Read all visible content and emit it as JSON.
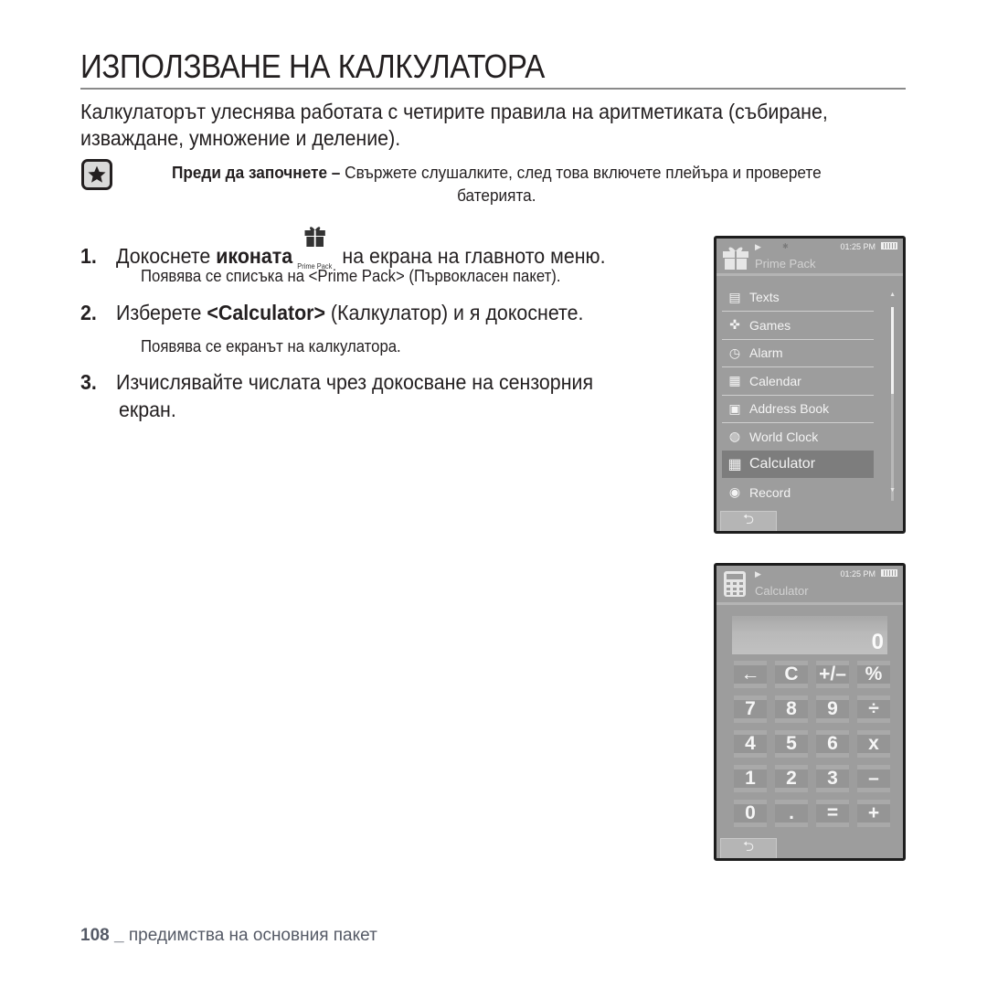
{
  "page": {
    "title": "ИЗПОЛЗВАНЕ НА КАЛКУЛАТОРА",
    "intro": "Калкулаторът улеснява работата с четирите правила на аритметиката (събиране, изваждане, умножение и деление).",
    "note": {
      "icon": "star-icon",
      "label": "Преди да започнете –",
      "text": "Свържете слушалките, след това включете плейъра и проверете батерията."
    },
    "steps": [
      {
        "num": "1.",
        "before": "Докоснете ",
        "bold": "иконата",
        "icon": "gift-icon",
        "icon_caption": "Prime Pack",
        "after": " на екрана на главното меню.",
        "sub": "Появява се списъка на <Prime Pack> (Първокласен пакет)."
      },
      {
        "num": "2.",
        "before": "Изберете ",
        "bold": "<Calculator>",
        "after": " (Калкулатор) и я докоснете.",
        "sub": "Появява се екранът на калкулатора."
      },
      {
        "num": "3.",
        "line1": "Изчислявайте числата чрез докосване на сензорния",
        "line2": "екран."
      }
    ],
    "footer": {
      "page_number": "108",
      "separator": "_",
      "section": "предимства на основния пакет"
    }
  },
  "screen_menu": {
    "status": {
      "play": "▶",
      "bluetooth": "✱",
      "time": "01:25 PM",
      "battery": "battery-icon"
    },
    "title": "Prime Pack",
    "items": [
      {
        "label": "Texts",
        "icon": "document-icon"
      },
      {
        "label": "Games",
        "icon": "gamepad-icon"
      },
      {
        "label": "Alarm",
        "icon": "alarm-icon"
      },
      {
        "label": "Calendar",
        "icon": "calendar-icon"
      },
      {
        "label": "Address Book",
        "icon": "address-book-icon"
      },
      {
        "label": "World Clock",
        "icon": "globe-icon"
      },
      {
        "label": "Calculator",
        "icon": "calculator-icon",
        "selected": true
      },
      {
        "label": "Record",
        "icon": "microphone-icon"
      }
    ],
    "back": "⮌"
  },
  "screen_calc": {
    "status": {
      "play": "▶",
      "time": "01:25 PM",
      "battery": "battery-icon"
    },
    "title": "Calculator",
    "display": "0",
    "keys": [
      [
        "←",
        "C",
        "+/–",
        "%"
      ],
      [
        "7",
        "8",
        "9",
        "÷"
      ],
      [
        "4",
        "5",
        "6",
        "x"
      ],
      [
        "1",
        "2",
        "3",
        "–"
      ],
      [
        "0",
        ".",
        "=",
        "+"
      ]
    ],
    "back": "⮌"
  }
}
